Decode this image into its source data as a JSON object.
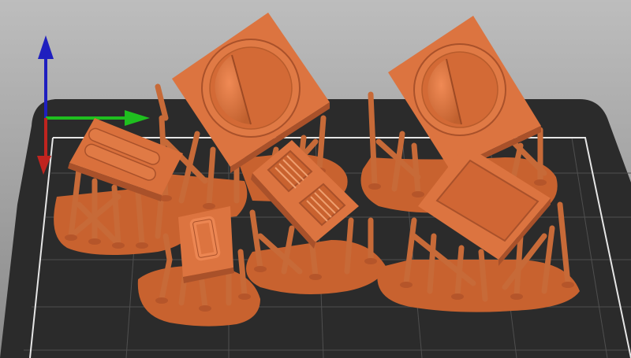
{
  "viewport": {
    "background_top": "#bdbdbd",
    "background_bottom": "#8a8a8a",
    "bed_color": "#2a2a2a",
    "bed_grid_color": "#5a5a5a",
    "bed_border_color": "#eaeaea",
    "model_color": "#d9703c",
    "model_shade_color": "#a9512a",
    "model_light_color": "#f08a55"
  },
  "axes": {
    "x_color": "#1fbf1f",
    "y_color": "#1f1fbf",
    "z_color": "#c0241f"
  },
  "objects": [
    {
      "name": "part-with-two-slots",
      "feature": "two-raised-bars"
    },
    {
      "name": "part-with-half-disc-1",
      "feature": "half-disc"
    },
    {
      "name": "part-with-half-disc-2",
      "feature": "half-disc"
    },
    {
      "name": "part-with-grilles",
      "feature": "two-grilles"
    },
    {
      "name": "part-with-rect-frame",
      "feature": "rect-frame"
    },
    {
      "name": "part-with-flat-panel",
      "feature": "flat-panel"
    }
  ]
}
